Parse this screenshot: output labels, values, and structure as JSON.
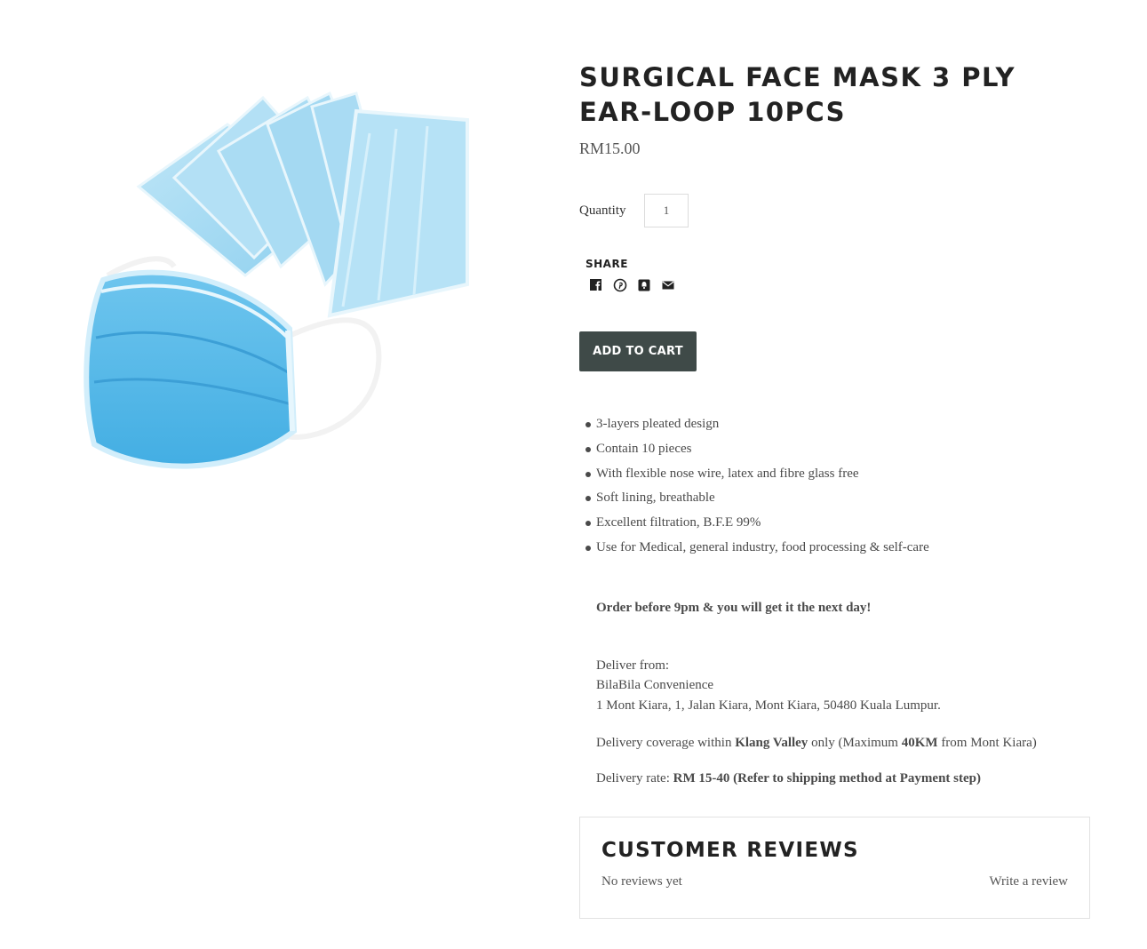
{
  "product": {
    "title": "SURGICAL FACE MASK 3 PLY EAR-LOOP 10PCS",
    "price": "RM15.00",
    "image_alt": "Surgical face masks"
  },
  "quantity": {
    "label": "Quantity",
    "value": "1"
  },
  "share": {
    "label": "SHARE",
    "icons": [
      "facebook-icon",
      "pinterest-icon",
      "fancy-icon",
      "email-icon"
    ]
  },
  "cart": {
    "add_label": "ADD TO CART",
    "color": "#3f4a48"
  },
  "features": [
    "3-layers pleated design",
    "Contain 10 pieces",
    "With flexible nose wire, latex and fibre glass free",
    "Soft lining, breathable",
    "Excellent filtration, B.F.E 99%",
    "Use for Medical, general industry, food processing & self-care"
  ],
  "delivery": {
    "order_note": "Order before 9pm & you will get it the next day!",
    "deliver_from_label": "Deliver from:",
    "store_name": "BilaBila Convenience",
    "address": "1 Mont Kiara, 1, Jalan Kiara, Mont Kiara, 50480 Kuala Lumpur.",
    "coverage_prefix": "Delivery coverage within ",
    "coverage_region": "Klang Valley",
    "coverage_middle": " only (Maximum ",
    "coverage_distance": "40KM",
    "coverage_suffix": " from Mont Kiara)",
    "rate_prefix": "Delivery rate: ",
    "rate_value": "RM 15-40 (Refer to shipping method at Payment step)"
  },
  "reviews": {
    "title": "CUSTOMER REVIEWS",
    "empty_text": "No reviews yet",
    "write_label": "Write a review"
  }
}
